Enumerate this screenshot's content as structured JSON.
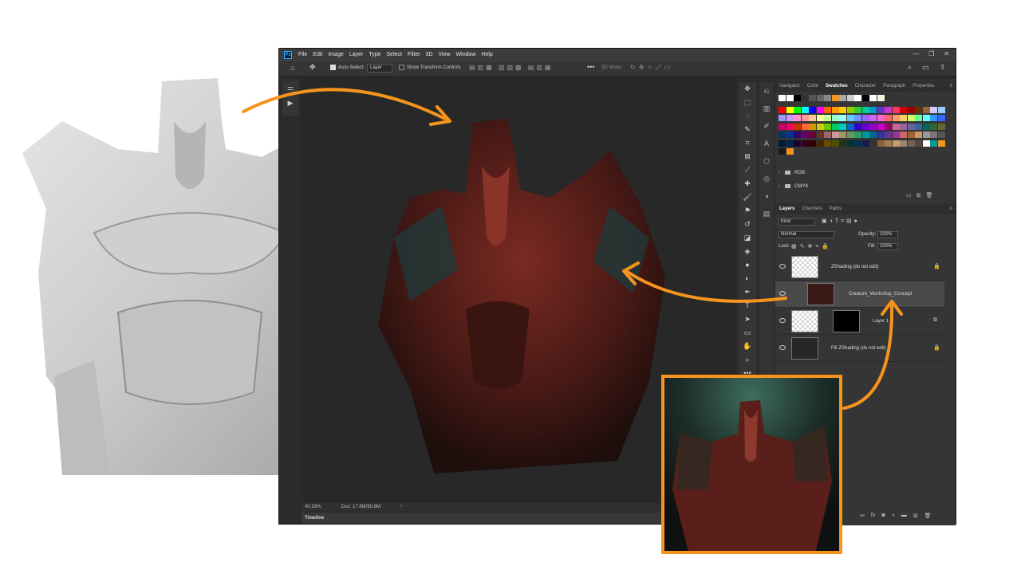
{
  "app": {
    "logo": "Ps"
  },
  "menu": [
    "File",
    "Edit",
    "Image",
    "Layer",
    "Type",
    "Select",
    "Filter",
    "3D",
    "View",
    "Window",
    "Help"
  ],
  "window_controls": [
    "—",
    "❐",
    "✕"
  ],
  "options_bar": {
    "auto_select_label": "Auto-Select:",
    "auto_select_value": "Layer",
    "show_transform_label": "Show Transform Controls",
    "mode_3d_label": "3D Mode:"
  },
  "status": {
    "zoom": "40.33%",
    "doc": "Doc: 17.6M/50.8M"
  },
  "timeline_label": "Timeline",
  "swatches_panel": {
    "tabs": [
      "Navigator",
      "Color",
      "Swatches",
      "Character",
      "Paragraph",
      "Properties"
    ],
    "active_tab": "Swatches",
    "folders": [
      "RGB",
      "CMYK"
    ],
    "colors": [
      [
        "#ffffff",
        "#ffffff",
        "#000000",
        "#333333",
        "#555555",
        "#666666",
        "#888888",
        "#f7941d",
        "#aaaaaa",
        "#cccccc",
        "#ffffff",
        "#000000",
        "#ffffff",
        "#f5f5dc"
      ],
      [
        "#ff0000",
        "#ffff00",
        "#00ff00",
        "#00ffff",
        "#0000ff",
        "#ff00ff",
        "#ff6600",
        "#ff9900",
        "#ffcc00",
        "#99cc00",
        "#33cc33",
        "#00cc99",
        "#0099cc",
        "#6633cc",
        "#cc33cc",
        "#ff3366",
        "#cc0000",
        "#990000",
        "#663300",
        "#996633",
        "#ccccff",
        "#99ccff"
      ],
      [
        "#9999ff",
        "#cc99ff",
        "#ff99cc",
        "#ff9999",
        "#ffcc99",
        "#ffff99",
        "#ccff99",
        "#99ffcc",
        "#99ffff",
        "#66ccff",
        "#6699ff",
        "#9966ff",
        "#cc66ff",
        "#ff66cc",
        "#ff6666",
        "#ff9966",
        "#ffcc66",
        "#ccff66",
        "#66ff99",
        "#66ffff",
        "#3399ff",
        "#3366ff"
      ],
      [
        "#cc0066",
        "#ff0066",
        "#cc3300",
        "#ff6633",
        "#cc9900",
        "#cccc00",
        "#66cc00",
        "#00cc66",
        "#00cccc",
        "#0066cc",
        "#3300cc",
        "#6600cc",
        "#9900cc",
        "#cc00cc",
        "#990066",
        "#cc6699",
        "#996699",
        "#666699",
        "#336699",
        "#006666",
        "#336633",
        "#666633"
      ],
      [
        "#003366",
        "#003399",
        "#330066",
        "#660066",
        "#660033",
        "#663333",
        "#996666",
        "#cc9999",
        "#999966",
        "#669966",
        "#339966",
        "#009999",
        "#006699",
        "#333399",
        "#663399",
        "#993399",
        "#cc6666",
        "#996633",
        "#cc9966",
        "#999999",
        "#777777",
        "#555555"
      ],
      [
        "#001a33",
        "#00264d",
        "#1a0033",
        "#33001a",
        "#330000",
        "#4d2600",
        "#664d00",
        "#4d4d00",
        "#1a331a",
        "#003333",
        "#00334d",
        "#1a1a4d",
        "#333333",
        "#8c6239",
        "#a67c52",
        "#c69c6d",
        "#998675",
        "#736357",
        "#534741",
        "#ffffff",
        "#009999",
        "#f7941d"
      ],
      [
        "#1a1a1a",
        "#f7941d"
      ]
    ]
  },
  "layers_panel": {
    "tabs": [
      "Layers",
      "Channels",
      "Paths"
    ],
    "active_tab": "Layers",
    "filter_label": "Kind",
    "blend_mode": "Normal",
    "opacity_label": "Opacity:",
    "opacity_value": "100%",
    "lock_label": "Lock:",
    "fill_label": "Fill:",
    "fill_value": "100%",
    "layers": [
      {
        "name": "ZShading (do not edit)"
      },
      {
        "name": "Creature_Workshop_Concept"
      },
      {
        "name": "Layer 1"
      },
      {
        "name": "Fill ZShading (do not edit)"
      }
    ],
    "footer_icons": [
      "link-icon",
      "fx",
      "mask-icon",
      "adjustment-icon",
      "group-icon",
      "new-layer-icon",
      "trash-icon"
    ]
  },
  "accent_color": "#f7941d"
}
